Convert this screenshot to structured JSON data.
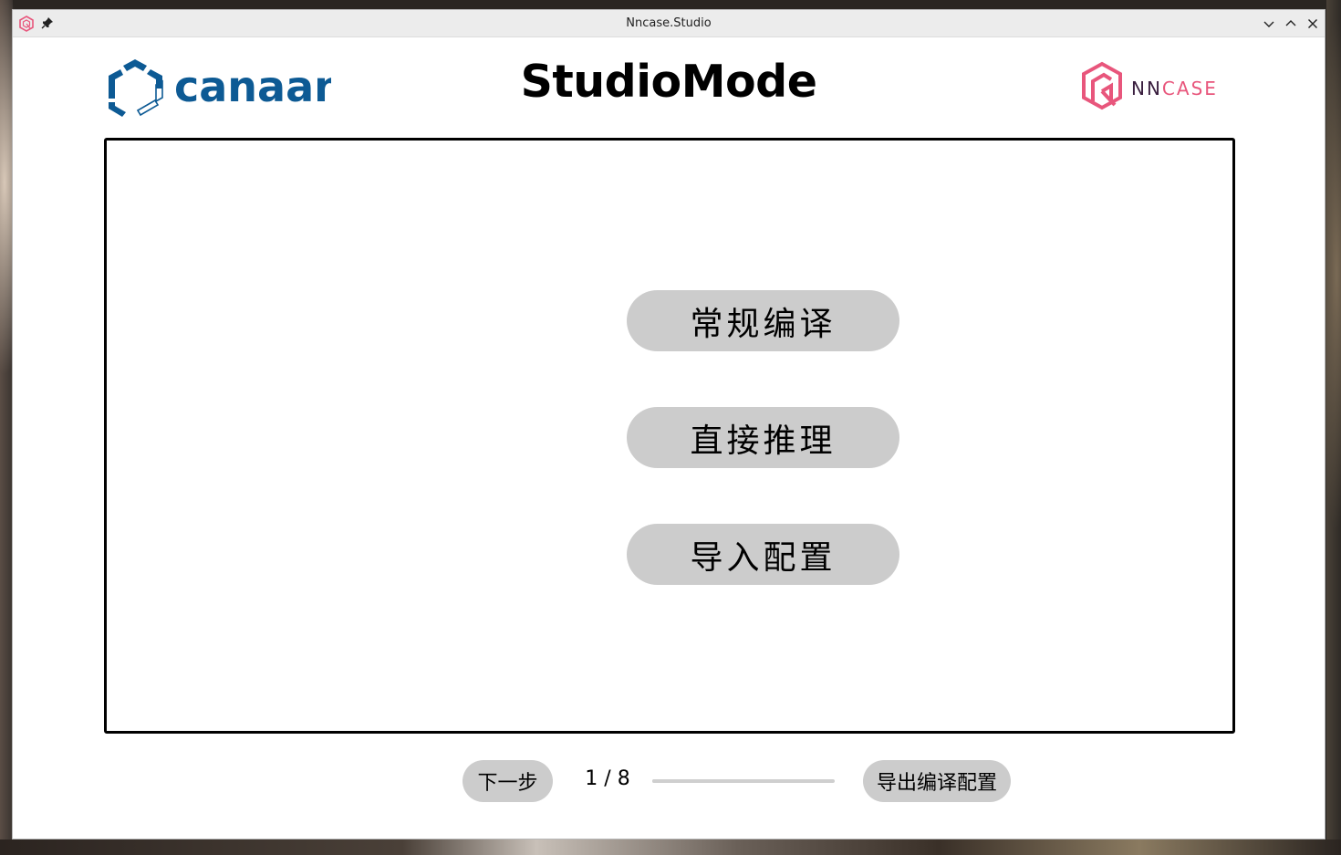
{
  "window": {
    "title": "Nncase.Studio"
  },
  "header": {
    "canaan_logo_text": "canaan",
    "page_title": "StudioMode",
    "nncase_logo_text": "NNCASE"
  },
  "modes": [
    {
      "label": "常规编译"
    },
    {
      "label": "直接推理"
    },
    {
      "label": "导入配置"
    }
  ],
  "footer": {
    "next_label": "下一步",
    "page_indicator": "1 / 8",
    "progress": 0.125,
    "export_label": "导出编译配置"
  },
  "colors": {
    "canaan_blue": "#0d5a94",
    "nncase_pink": "#e8567c",
    "button_gray": "#cccccc"
  },
  "icons": {
    "app": "nncase-app-icon",
    "pin": "pin-icon",
    "minimize": "chevron-down-icon",
    "maximize": "chevron-up-icon",
    "close": "close-icon"
  }
}
